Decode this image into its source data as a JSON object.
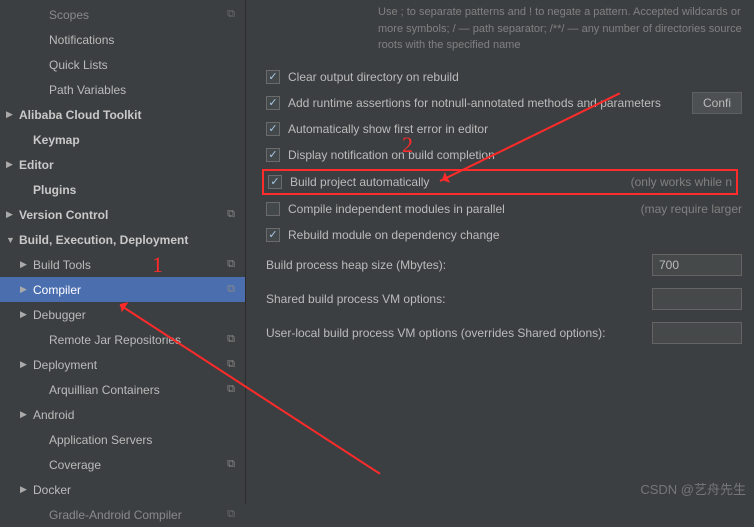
{
  "sidebar": {
    "items": [
      {
        "label": "Scopes",
        "indent": 2,
        "arrow": "none",
        "copy": true,
        "faded": true
      },
      {
        "label": "Notifications",
        "indent": 2,
        "arrow": "none"
      },
      {
        "label": "Quick Lists",
        "indent": 2,
        "arrow": "none"
      },
      {
        "label": "Path Variables",
        "indent": 2,
        "arrow": "none"
      },
      {
        "label": "Alibaba Cloud Toolkit",
        "indent": 0,
        "arrow": "right",
        "bold": true
      },
      {
        "label": "Keymap",
        "indent": 1,
        "arrow": "none",
        "bold": true
      },
      {
        "label": "Editor",
        "indent": 0,
        "arrow": "right",
        "bold": true
      },
      {
        "label": "Plugins",
        "indent": 1,
        "arrow": "none",
        "bold": true
      },
      {
        "label": "Version Control",
        "indent": 0,
        "arrow": "right",
        "bold": true,
        "copy": true
      },
      {
        "label": "Build, Execution, Deployment",
        "indent": 0,
        "arrow": "down",
        "bold": true
      },
      {
        "label": "Build Tools",
        "indent": 1,
        "arrow": "right",
        "copy": true
      },
      {
        "label": "Compiler",
        "indent": 1,
        "arrow": "right",
        "copy": true,
        "selected": true
      },
      {
        "label": "Debugger",
        "indent": 1,
        "arrow": "right"
      },
      {
        "label": "Remote Jar Repositories",
        "indent": 2,
        "arrow": "none",
        "copy": true
      },
      {
        "label": "Deployment",
        "indent": 1,
        "arrow": "right",
        "copy": true
      },
      {
        "label": "Arquillian Containers",
        "indent": 2,
        "arrow": "none",
        "copy": true
      },
      {
        "label": "Android",
        "indent": 1,
        "arrow": "right"
      },
      {
        "label": "Application Servers",
        "indent": 2,
        "arrow": "none"
      },
      {
        "label": "Coverage",
        "indent": 2,
        "arrow": "none",
        "copy": true
      },
      {
        "label": "Docker",
        "indent": 1,
        "arrow": "right"
      },
      {
        "label": "Gradle-Android Compiler",
        "indent": 2,
        "arrow": "none",
        "copy": true,
        "faded": true
      }
    ]
  },
  "content": {
    "help": "Use ; to separate patterns and ! to negate a pattern. Accepted wildcards or more symbols; / — path separator; /**/ — any number of directories source roots with the specified name",
    "checks": [
      {
        "label": "Clear output directory on rebuild",
        "checked": true
      },
      {
        "label": "Add runtime assertions for notnull-annotated methods and parameters",
        "checked": true,
        "button": "Confi"
      },
      {
        "label": "Automatically show first error in editor",
        "checked": true
      },
      {
        "label": "Display notification on build completion",
        "checked": true
      },
      {
        "label": "Build project automatically",
        "checked": true,
        "highlight": true,
        "hint": "(only works while n"
      },
      {
        "label": "Compile independent modules in parallel",
        "checked": false,
        "hint": "(may require larger"
      },
      {
        "label": "Rebuild module on dependency change",
        "checked": true
      }
    ],
    "heap_label": "Build process heap size (Mbytes):",
    "heap_value": "700",
    "shared_label": "Shared build process VM options:",
    "shared_value": "",
    "user_label": "User-local build process VM options (overrides Shared options):",
    "user_value": ""
  },
  "annotations": {
    "n1": "1",
    "n2": "2"
  },
  "watermark": "CSDN @艺舟先生"
}
